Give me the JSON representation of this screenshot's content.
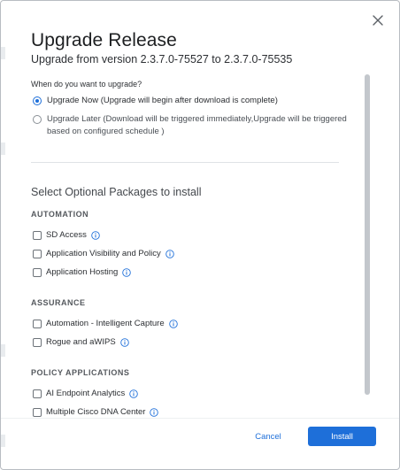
{
  "dialog": {
    "title": "Upgrade Release",
    "subtitle": "Upgrade from version 2.3.7.0-75527 to 2.3.7.0-75535",
    "question": "When do you want to upgrade?",
    "options": [
      {
        "label": "Upgrade Now (Upgrade will begin after download is complete)",
        "selected": true
      },
      {
        "label": "Upgrade Later (Download will be triggered immediately,Upgrade will be triggered based on configured schedule )",
        "selected": false
      }
    ],
    "packages_title": "Select Optional Packages to install",
    "groups": [
      {
        "name": "AUTOMATION",
        "items": [
          "SD Access",
          "Application Visibility and Policy",
          "Application Hosting"
        ]
      },
      {
        "name": "ASSURANCE",
        "items": [
          "Automation - Intelligent Capture",
          "Rogue and aWIPS"
        ]
      },
      {
        "name": "POLICY APPLICATIONS",
        "items": [
          "AI Endpoint Analytics",
          "Multiple Cisco DNA Center"
        ]
      }
    ],
    "cancel_label": "Cancel",
    "install_label": "Install"
  },
  "colors": {
    "accent": "#1e6fd9",
    "text": "#1d1f21",
    "muted": "#55595e"
  },
  "icons": {
    "close": "close-icon",
    "info": "info-icon"
  }
}
